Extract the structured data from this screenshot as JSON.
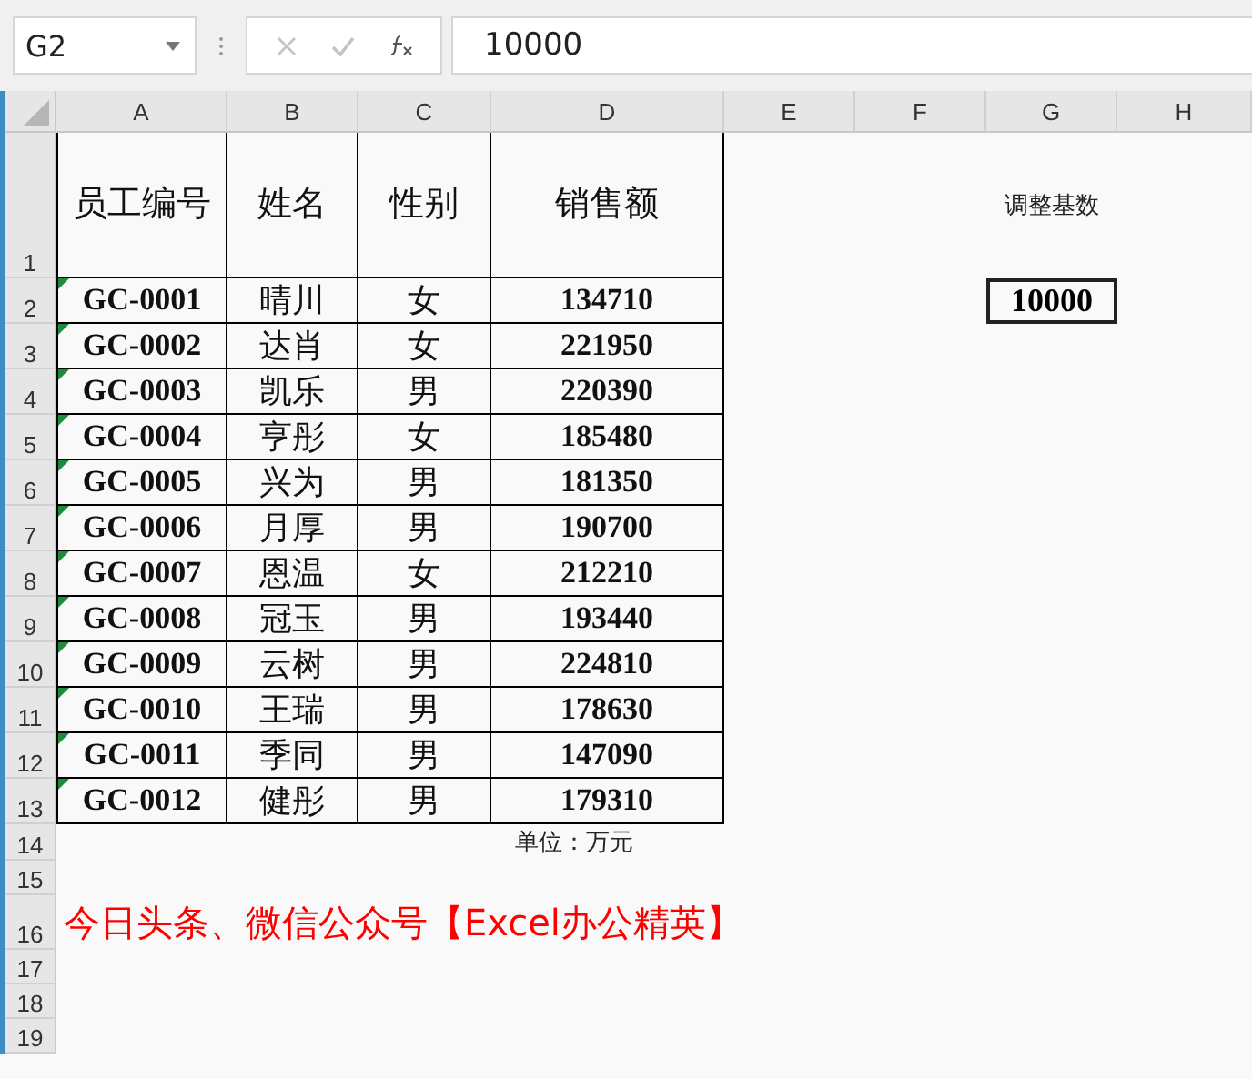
{
  "name_box": {
    "value": "G2"
  },
  "formula_bar": {
    "value": "10000"
  },
  "columns": [
    "A",
    "B",
    "C",
    "D",
    "E",
    "F",
    "G",
    "H"
  ],
  "rows": [
    {
      "number": "1",
      "kind": "header",
      "cells": [
        "员工编号",
        "姓名",
        "性别",
        "销售额"
      ],
      "side": {
        "text": "调整基数",
        "selected": false
      }
    },
    {
      "number": "2",
      "kind": "data",
      "cells": [
        "GC-0001",
        "晴川",
        "女",
        "134710"
      ],
      "side": {
        "text": "10000",
        "selected": true
      }
    },
    {
      "number": "3",
      "kind": "data",
      "cells": [
        "GC-0002",
        "达肖",
        "女",
        "221950"
      ]
    },
    {
      "number": "4",
      "kind": "data",
      "cells": [
        "GC-0003",
        "凯乐",
        "男",
        "220390"
      ]
    },
    {
      "number": "5",
      "kind": "data",
      "cells": [
        "GC-0004",
        "亨彤",
        "女",
        "185480"
      ]
    },
    {
      "number": "6",
      "kind": "data",
      "cells": [
        "GC-0005",
        "兴为",
        "男",
        "181350"
      ]
    },
    {
      "number": "7",
      "kind": "data",
      "cells": [
        "GC-0006",
        "月厚",
        "男",
        "190700"
      ]
    },
    {
      "number": "8",
      "kind": "data",
      "cells": [
        "GC-0007",
        "恩温",
        "女",
        "212210"
      ]
    },
    {
      "number": "9",
      "kind": "data",
      "cells": [
        "GC-0008",
        "冠玉",
        "男",
        "193440"
      ]
    },
    {
      "number": "10",
      "kind": "data",
      "cells": [
        "GC-0009",
        "云树",
        "男",
        "224810"
      ]
    },
    {
      "number": "11",
      "kind": "data",
      "cells": [
        "GC-0010",
        "王瑞",
        "男",
        "178630"
      ]
    },
    {
      "number": "12",
      "kind": "data",
      "cells": [
        "GC-0011",
        "季同",
        "男",
        "147090"
      ]
    },
    {
      "number": "13",
      "kind": "data",
      "cells": [
        "GC-0012",
        "健彤",
        "男",
        "179310"
      ]
    },
    {
      "number": "14",
      "kind": "unit",
      "text": "单位：万元"
    },
    {
      "number": "15",
      "kind": "blank"
    },
    {
      "number": "16",
      "kind": "banner",
      "text": "今日头条、微信公众号【Excel办公精英】"
    },
    {
      "number": "17",
      "kind": "blank"
    },
    {
      "number": "18",
      "kind": "blank"
    },
    {
      "number": "19",
      "kind": "blank"
    }
  ]
}
